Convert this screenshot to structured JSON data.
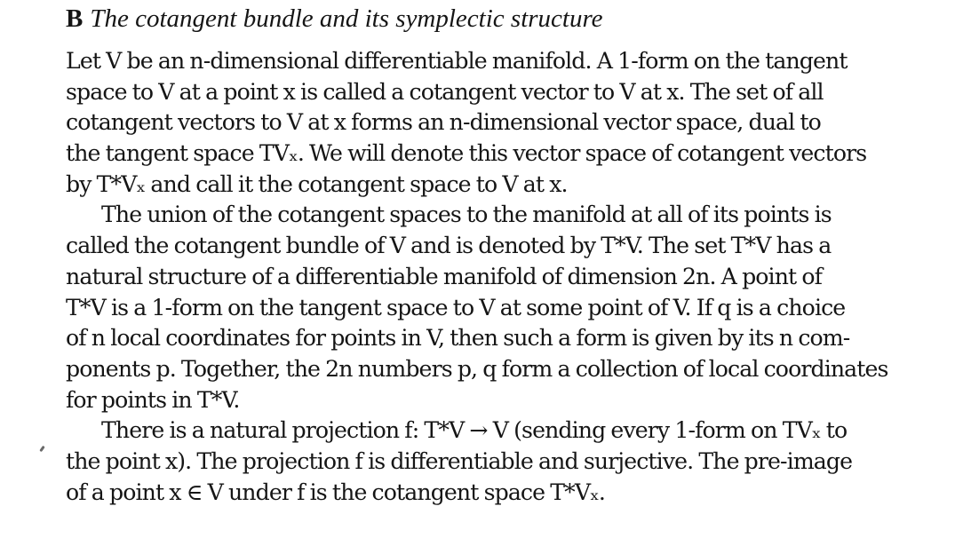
{
  "section": {
    "letter": "B",
    "title": "The cotangent bundle and its symplectic structure"
  },
  "lines": [
    {
      "text": "Let V be an n-dimensional differentiable manifold. A 1-form on the tangent",
      "indent": false
    },
    {
      "text": "space to V at a point x is called a cotangent vector to V at x. The set of all",
      "indent": false
    },
    {
      "text": "cotangent vectors to V at x forms an n-dimensional vector space, dual to",
      "indent": false
    },
    {
      "text": "the tangent space TVₓ. We will denote this vector space of cotangent vectors",
      "indent": false
    },
    {
      "text": "by T*Vₓ and call it the cotangent space to V at x.",
      "indent": false
    },
    {
      "text": "The union of the cotangent spaces to the manifold at all of its points is",
      "indent": true
    },
    {
      "text": "called the cotangent bundle of V and is denoted by T*V. The set T*V has a",
      "indent": false
    },
    {
      "text": "natural structure of a differentiable manifold of dimension 2n. A point of",
      "indent": false
    },
    {
      "text": "T*V is a 1-form on the tangent space to V at some point of V. If q is a choice",
      "indent": false
    },
    {
      "text": "of n local coordinates for points in V, then such a form is given by its n com-",
      "indent": false
    },
    {
      "text": "ponents p. Together, the 2n numbers p, q form a collection of local coordinates",
      "indent": false
    },
    {
      "text": "for points in T*V.",
      "indent": false
    },
    {
      "text": "There is a natural projection f: T*V → V (sending every 1-form on TVₓ to",
      "indent": true
    },
    {
      "text": "the point x). The projection f is differentiable and surjective. The pre-image",
      "indent": false
    },
    {
      "text": "of a point x ∈ V under f is the cotangent space T*Vₓ.",
      "indent": false
    }
  ]
}
